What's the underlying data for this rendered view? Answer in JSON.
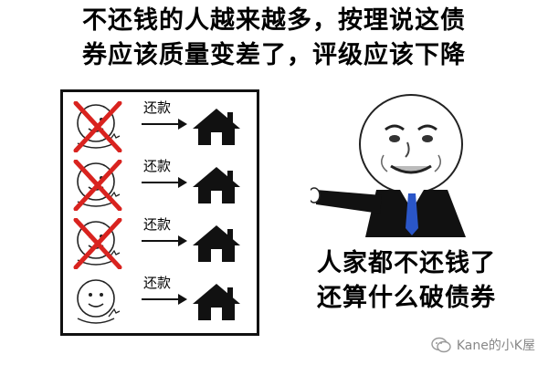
{
  "title": {
    "line1": "不还钱的人越来越多，按理说这债",
    "line2": "券应该质量变差了，评级应该下降"
  },
  "diagram": {
    "rows": [
      {
        "label": "还款",
        "crossed": true
      },
      {
        "label": "还款",
        "crossed": true
      },
      {
        "label": "还款",
        "crossed": true
      },
      {
        "label": "还款",
        "crossed": false
      }
    ]
  },
  "caption": {
    "line1": "人家都不还钱了",
    "line2": "还算什么破债券"
  },
  "watermark": {
    "text": "Kane的小K屋",
    "icon": "wechat-icon"
  },
  "colors": {
    "cross": "#d9231f",
    "tie": "#2a56c8",
    "suit": "#111111",
    "watermark": "#888888"
  }
}
